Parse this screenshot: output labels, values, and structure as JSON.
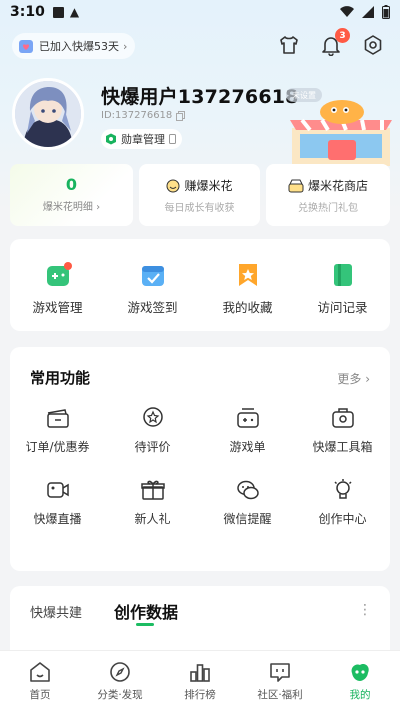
{
  "status_bar": {
    "time": "3:10"
  },
  "header": {
    "joined_text": "已加入快爆53天",
    "notification_count": "3"
  },
  "profile": {
    "username": "快爆用户137276618",
    "user_id": "ID:137276618",
    "medal_label": "勋章管理",
    "level_tag": "未设置"
  },
  "stats": [
    {
      "value": "0",
      "label": "爆米花明细 ›"
    },
    {
      "title": "赚爆米花",
      "sub": "每日成长有收获"
    },
    {
      "title": "爆米花商店",
      "sub": "兑换热门礼包"
    }
  ],
  "quick": [
    {
      "label": "游戏管理",
      "icon": "gamepad-icon"
    },
    {
      "label": "游戏签到",
      "icon": "checkin-icon"
    },
    {
      "label": "我的收藏",
      "icon": "bookmark-icon"
    },
    {
      "label": "访问记录",
      "icon": "history-icon"
    }
  ],
  "common": {
    "title": "常用功能",
    "more": "更多 ›",
    "items": [
      {
        "label": "订单/优惠券",
        "icon": "coupon-icon"
      },
      {
        "label": "待评价",
        "icon": "review-icon"
      },
      {
        "label": "游戏单",
        "icon": "game-list-icon"
      },
      {
        "label": "快爆工具箱",
        "icon": "toolbox-icon"
      },
      {
        "label": "快爆直播",
        "icon": "live-icon"
      },
      {
        "label": "新人礼",
        "icon": "gift-icon"
      },
      {
        "label": "微信提醒",
        "icon": "wechat-icon"
      },
      {
        "label": "创作中心",
        "icon": "creator-icon"
      }
    ]
  },
  "creation": {
    "tab_a": "快爆共建",
    "tab_b": "创作数据"
  },
  "nav": [
    {
      "label": "首页"
    },
    {
      "label": "分类·发现"
    },
    {
      "label": "排行榜"
    },
    {
      "label": "社区·福利"
    },
    {
      "label": "我的"
    }
  ],
  "colors": {
    "accent": "#18b35e",
    "badge": "#ff5a44"
  }
}
